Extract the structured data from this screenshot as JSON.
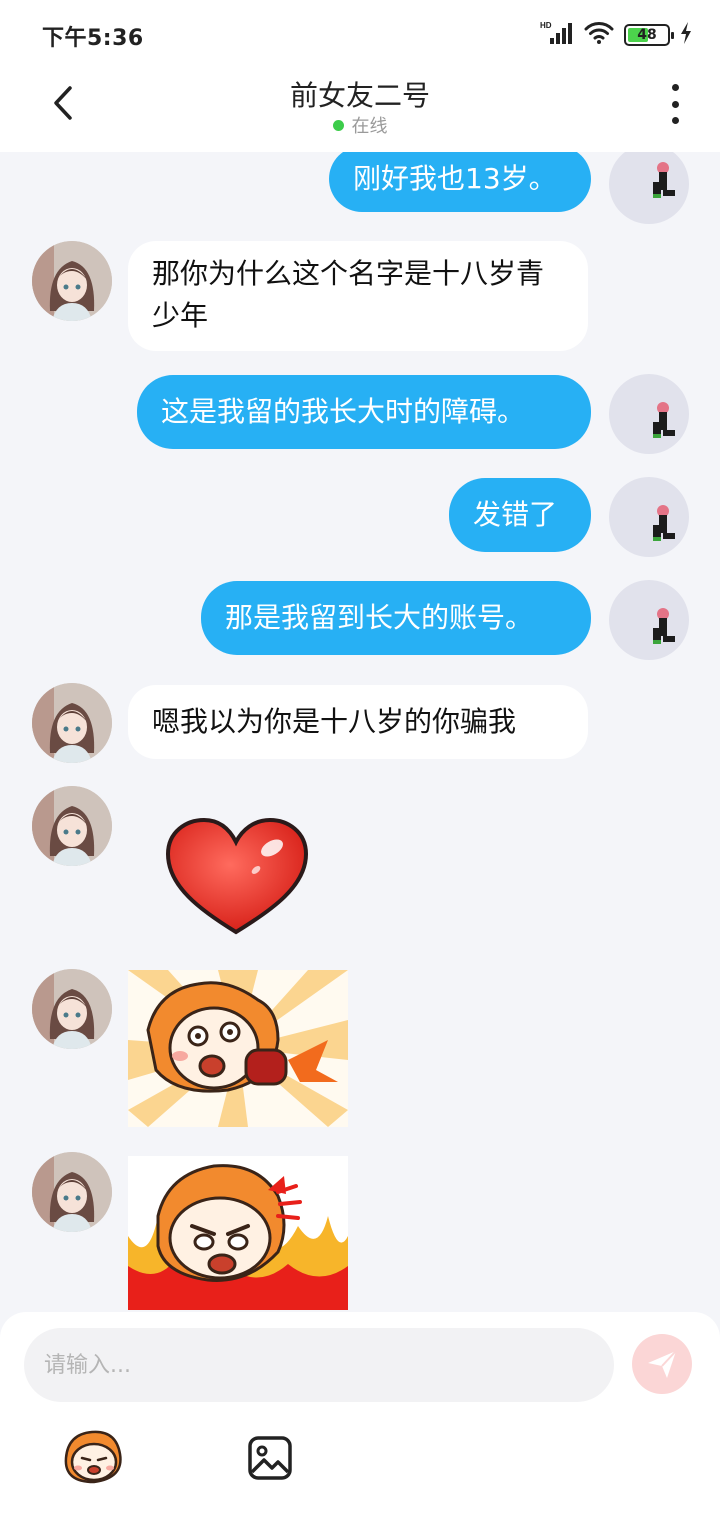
{
  "status_bar": {
    "time": "下午5:36",
    "battery": "48",
    "network": "HD"
  },
  "header": {
    "title": "前女友二号",
    "status": "在线"
  },
  "messages": [
    {
      "from": "me",
      "type": "text",
      "text": "刚好我也13岁。"
    },
    {
      "from": "her",
      "type": "text",
      "text": "那你为什么这个名字是十八岁青少年"
    },
    {
      "from": "me",
      "type": "text",
      "text": "这是我留的我长大时的障碍。"
    },
    {
      "from": "me",
      "type": "text",
      "text": "发错了"
    },
    {
      "from": "me",
      "type": "text",
      "text": "那是我留到长大的账号。"
    },
    {
      "from": "her",
      "type": "text",
      "text": "嗯我以为你是十八岁的你骗我"
    },
    {
      "from": "her",
      "type": "sticker",
      "sticker": "red-heart"
    },
    {
      "from": "her",
      "type": "sticker",
      "sticker": "cartoon-punch"
    },
    {
      "from": "her",
      "type": "sticker",
      "sticker": "cartoon-angry-fire"
    }
  ],
  "composer": {
    "placeholder": "请输入..."
  },
  "colors": {
    "outgoing_bubble": "#27b0f4",
    "online": "#3ccc4a",
    "send_button": "#fbd6d6"
  }
}
